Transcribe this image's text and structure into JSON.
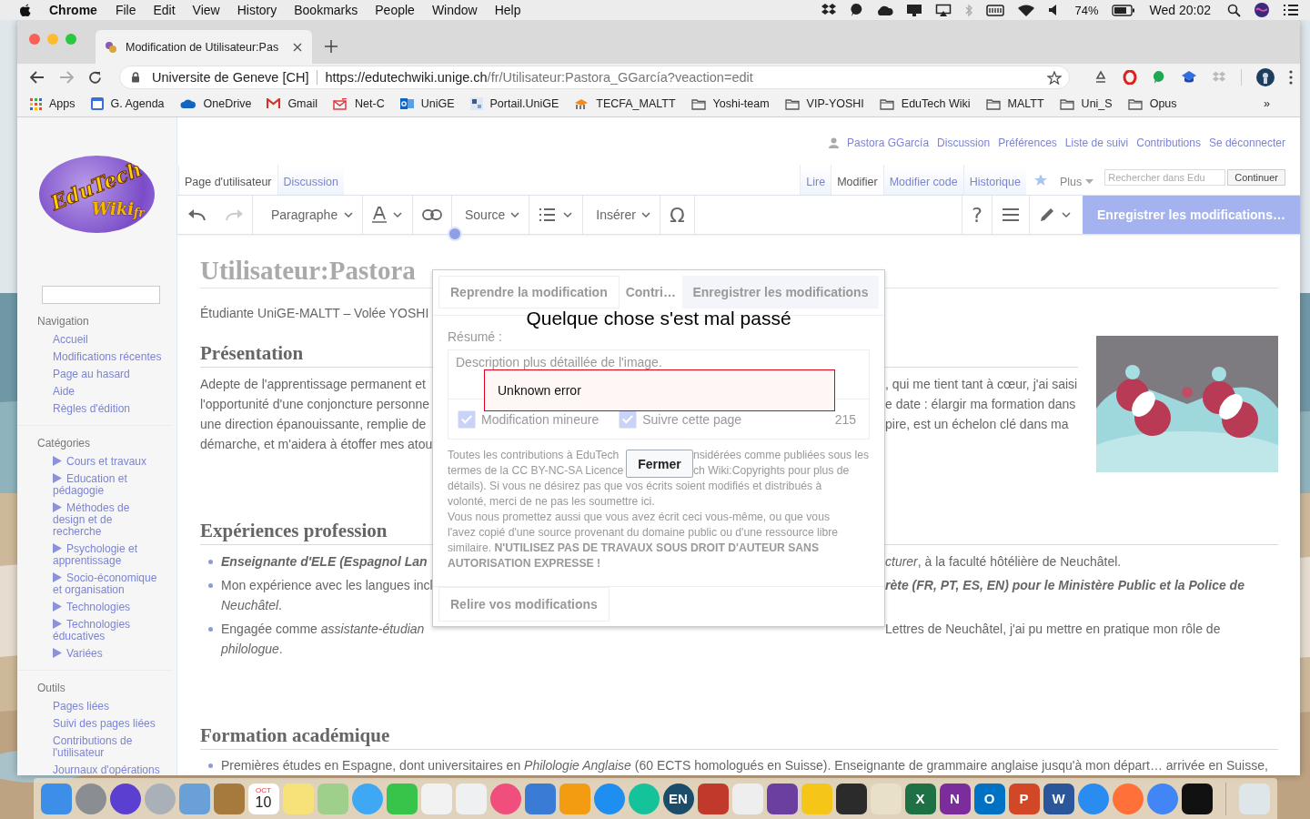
{
  "menubar": {
    "app": "Chrome",
    "menus": [
      "File",
      "Edit",
      "View",
      "History",
      "Bookmarks",
      "People",
      "Window",
      "Help"
    ],
    "battery_percent": "74%",
    "clock": "Wed 20:02"
  },
  "browser": {
    "tab": {
      "title": "Modification de Utilisateur:Pas",
      "selected": true
    },
    "site_identity": "Universite de Geneve [CH]",
    "url": {
      "origin": "https://edutechwiki.unige.ch",
      "path": "/fr/Utilisateur:Pastora_GGarcía?veaction=edit"
    },
    "bookmarks": [
      {
        "label": "Apps",
        "kind": "apps"
      },
      {
        "label": "G. Agenda",
        "kind": "calendar"
      },
      {
        "label": "OneDrive",
        "kind": "cloud"
      },
      {
        "label": "Gmail",
        "kind": "mail"
      },
      {
        "label": "Net-C",
        "kind": "envelope"
      },
      {
        "label": "UniGE",
        "kind": "outlook"
      },
      {
        "label": "Portail.UniGE",
        "kind": "site"
      },
      {
        "label": "TECFA_MALTT",
        "kind": "hat"
      },
      {
        "label": "Yoshi-team",
        "kind": "folder"
      },
      {
        "label": "VIP-YOSHI",
        "kind": "folder"
      },
      {
        "label": "EduTech Wiki",
        "kind": "folder"
      },
      {
        "label": "MALTT",
        "kind": "folder"
      },
      {
        "label": "Uni_S",
        "kind": "folder"
      },
      {
        "label": "Opus",
        "kind": "folder"
      }
    ],
    "bookmarks_overflow": "»"
  },
  "wiki": {
    "logo": {
      "main": "EduTech",
      "sub": "Wiki",
      "lang": "fr"
    },
    "sidebar": [
      {
        "title": "Navigation",
        "items": [
          {
            "label": "Accueil"
          },
          {
            "label": "Modifications récentes"
          },
          {
            "label": "Page au hasard"
          },
          {
            "label": "Aide"
          },
          {
            "label": "Règles d'édition"
          }
        ]
      },
      {
        "title": "Catégories",
        "items": [
          {
            "label": "Cours et travaux",
            "expanded": false
          },
          {
            "label": "Education et pédagogie",
            "expanded": false
          },
          {
            "label": "Méthodes de design et de recherche",
            "expanded": false
          },
          {
            "label": "Psychologie et apprentissage",
            "expanded": false
          },
          {
            "label": "Socio-économique et organisation",
            "expanded": false
          },
          {
            "label": "Technologies",
            "expanded": false
          },
          {
            "label": "Technologies éducatives",
            "expanded": false
          },
          {
            "label": "Variées",
            "expanded": false
          }
        ]
      },
      {
        "title": "Outils",
        "items": [
          {
            "label": "Pages liées"
          },
          {
            "label": "Suivi des pages liées"
          },
          {
            "label": "Contributions de l'utilisateur"
          },
          {
            "label": "Journaux d'opérations"
          }
        ]
      }
    ],
    "personal": {
      "user": "Pastora GGarcía",
      "links": [
        "Discussion",
        "Préférences",
        "Liste de suivi",
        "Contributions",
        "Se déconnecter"
      ]
    },
    "namespace_tabs": [
      {
        "label": "Page d'utilisateur",
        "selected": true
      },
      {
        "label": "Discussion",
        "selected": false
      }
    ],
    "view_tabs": [
      {
        "label": "Lire",
        "selected": false
      },
      {
        "label": "Modifier",
        "selected": true
      },
      {
        "label": "Modifier code",
        "selected": false
      },
      {
        "label": "Historique",
        "selected": false
      }
    ],
    "more": "Plus",
    "search": {
      "placeholder": "Rechercher dans Edu"
    },
    "search_button": "Continuer",
    "toolbar": {
      "format": "Paragraphe",
      "source": "Source",
      "insert": "Insérer",
      "special": "Ω",
      "help": "?",
      "save": "Enregistrer les modifications…"
    },
    "article": {
      "title": "Utilisateur:Pastora",
      "intro": "Étudiante UniGE-MALTT – Volée YOSHI",
      "presentation": {
        "heading": "Présentation",
        "lines": [
          {
            "left": {
              "text": "Adepte de l'apprentissage permanent et",
              "emphasis": false
            },
            "right": {
              "text": ", qui me tient tant à cœur, j'ai saisi",
              "emphasis": false
            }
          },
          {
            "left": {
              "text": "l'opportunité d'une conjoncture personne",
              "emphasis": false
            },
            "right": {
              "text": "e date : élargir ma formation dans",
              "emphasis": false
            }
          },
          {
            "left": {
              "text": "une direction épanouissante, remplie de",
              "emphasis": false
            },
            "right": {
              "text": "pire, est un échelon clé dans ma",
              "emphasis": false
            }
          },
          {
            "left": {
              "text": "démarche, et m'aidera à étoffer mes atou",
              "emphasis": false
            }
          }
        ]
      },
      "experiences": {
        "heading": "Expériences profession",
        "bullets": [
          {
            "lines": [
              {
                "left": {
                  "text": "Enseignante d'ELE (Espagnol Lan",
                  "emphasis": true
                },
                "right": {
                  "text": "*cturer*, à la faculté hôtélière de Neuchâtel.",
                  "emphasis": false
                }
              }
            ]
          },
          {
            "lines": [
              {
                "left": {
                  "text": "Mon expérience avec les langues incl",
                  "emphasis": false
                },
                "right": {
                  "text": "rète (FR, PT, ES, EN) pour le Ministère Public et la Police de",
                  "emphasis": true
                }
              },
              {
                "left": {
                  "text": "*Neuchâtel*.",
                  "emphasis": false
                }
              }
            ]
          },
          {
            "lines": [
              {
                "left": {
                  "text": "Engagée comme *assistante-étudian*",
                  "emphasis": false
                },
                "right": {
                  "text": "Lettres de Neuchâtel, j'ai pu mettre en pratique mon rôle de",
                  "emphasis": false
                }
              },
              {
                "left": {
                  "text": "*philologue*.",
                  "emphasis": false
                }
              }
            ]
          }
        ]
      },
      "formation": {
        "heading": "Formation académique",
        "bullets": [
          "Premières études en Espagne, dont universitaires en *Philologie Anglaise* (60 ECTS homologués en Suisse). Enseignante de grammaire anglaise jusqu'à mon départ… arrivée en Suisse,"
        ]
      }
    }
  },
  "dialog": {
    "title": "Quelque chose s'est mal passé",
    "error": "Unknown error",
    "close_button": "Fermer",
    "behind": {
      "resume_button": "Reprendre la modification",
      "tab": "Contri…",
      "save_button": "Enregistrer les modifications",
      "summary_label": "Résumé :",
      "summary_placeholder": "Description plus détaillée de l'image.",
      "checkboxes": [
        {
          "label": "Modification mineure",
          "checked": true
        },
        {
          "label": "Suivre cette page",
          "checked": true
        }
      ],
      "char_count": "215",
      "legal_split": [
        {
          "left": "Toutes les contributions à EduTech",
          "right": "nsidérées comme publiées sous les"
        },
        {
          "left": "termes de la CC BY-NC-SA Licence",
          "right": "ch Wiki:Copyrights pour plus de"
        }
      ],
      "legal": [
        {
          "text": "détails). Si vous ne désirez pas que vos écrits soient modifiés et distribués à",
          "strong": false
        },
        {
          "text": "volonté, merci de ne pas les soumettre ici.",
          "strong": false
        },
        {
          "text": "Vous nous promettez aussi que vous avez écrit ceci vous-même, ou que vous",
          "strong": false
        },
        {
          "text": "l'avez copié d'une source provenant du domaine public ou d'une ressource libre",
          "strong": false
        },
        {
          "text": "similaire. **N'UTILISEZ PAS DE TRAVAUX SOUS DROIT D'AUTEUR SANS**",
          "strong": false
        },
        {
          "text": "AUTORISATION EXPRESSE !",
          "strong": true
        }
      ],
      "review_button": "Relire vos modifications"
    }
  },
  "dock": {
    "labels": [
      "OCT",
      "10",
      "EN",
      "X",
      "N",
      "O",
      "P",
      "W"
    ]
  }
}
